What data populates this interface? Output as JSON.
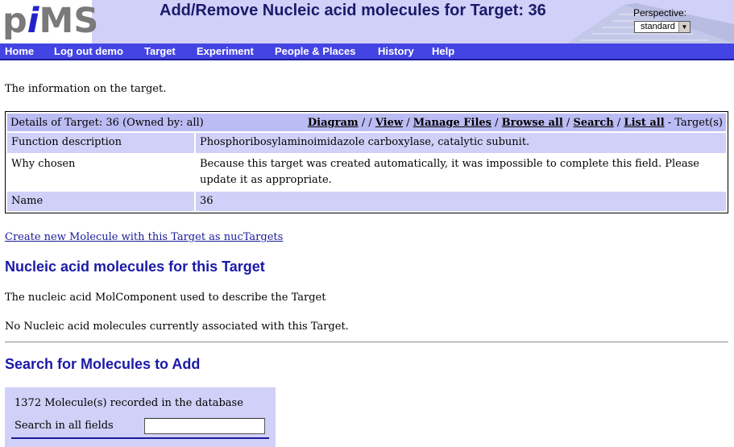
{
  "header": {
    "logo_prefix": "p",
    "logo_i": "i",
    "logo_suffix": "MS",
    "title": "Add/Remove Nucleic acid molecules for Target: 36",
    "perspective_label": "Perspective:",
    "perspective_value": "standard"
  },
  "nav": {
    "items": [
      "Home",
      "Log out demo",
      "Target",
      "Experiment",
      "People & Places",
      "History",
      "Help"
    ]
  },
  "intro_text": "The information on the target.",
  "details": {
    "header_left": "Details of  Target: 36 (Owned by: all)",
    "links": {
      "diagram": "Diagram",
      "sep1": " / / ",
      "view": "View",
      "sep2": " / ",
      "manage_files": "Manage Files",
      "sep3": " / ",
      "browse_all": "Browse all",
      "sep4": " / ",
      "search": "Search",
      "sep5": " / ",
      "list_all": "List all",
      "suffix": " - Target(s)"
    },
    "rows": [
      {
        "label": "Function description",
        "value": "Phosphoribosylaminoimidazole carboxylase, catalytic subunit."
      },
      {
        "label": "Why chosen",
        "value": "Because this target was created automatically, it was impossible to complete this field. Please update it as appropriate."
      },
      {
        "label": "Name",
        "value": "36"
      }
    ]
  },
  "create_link": "Create new Molecule with this Target as nucTargets",
  "section1": {
    "heading": "Nucleic acid molecules for this Target",
    "description": "The nucleic acid MolComponent used to describe the Target",
    "empty_message": "No Nucleic acid molecules currently associated with this Target."
  },
  "section2": {
    "heading": "Search for Molecules to Add",
    "count_text": "1372 Molecule(s) recorded in the database",
    "search_label": "Search in all fields",
    "search_value": ""
  },
  "colors": {
    "header_bg": "#d0d0f8",
    "nav_bg": "#4444e4",
    "heading_blue": "#1a1aa8"
  }
}
